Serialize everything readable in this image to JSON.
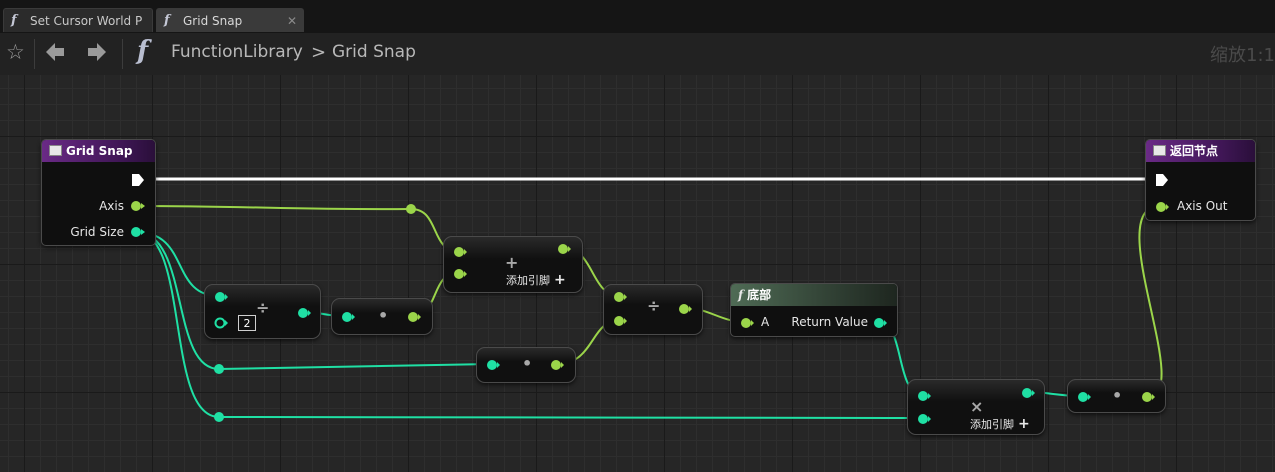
{
  "tabs": [
    {
      "label": "Set Cursor World P",
      "icon": "function-icon"
    },
    {
      "label": "Grid Snap",
      "icon": "function-icon",
      "close": "✕"
    }
  ],
  "toolbar": {
    "breadcrumb_root": "FunctionLibrary",
    "breadcrumb_sep": ">",
    "breadcrumb_current": "Grid Snap",
    "zoom": "缩放1:1"
  },
  "nodes": {
    "entry": {
      "title": "Grid Snap",
      "pin_axis": "Axis",
      "pin_grid": "Grid Size"
    },
    "ret": {
      "title": "返回节点",
      "pin_out": "Axis Out"
    },
    "div1": {
      "symbol": "÷",
      "const": "2"
    },
    "dot1": {
      "symbol": "•"
    },
    "add": {
      "symbol": "+",
      "add_pin": "添加引脚"
    },
    "div2": {
      "symbol": "÷"
    },
    "dot2": {
      "symbol": "•"
    },
    "floor": {
      "title": "底部",
      "pin_a": "A",
      "pin_ret": "Return Value"
    },
    "mul": {
      "symbol": "×",
      "add_pin": "添加引脚"
    },
    "dot3": {
      "symbol": "•"
    }
  },
  "colors": {
    "float_pin": "#9bd54a",
    "int_pin": "#1fe0a4",
    "exec": "#ffffff",
    "accent_header": "#6a2a86"
  }
}
